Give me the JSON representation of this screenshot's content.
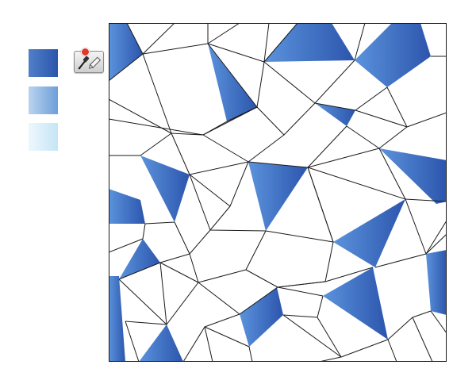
{
  "swatches": [
    {
      "name": "dark-blue-gradient",
      "from": "#4f80c8",
      "to": "#2c55ad"
    },
    {
      "name": "medium-blue-gradient",
      "from": "#b9d4ee",
      "to": "#6d9ed9"
    },
    {
      "name": "light-blue-gradient",
      "from": "#eef7fd",
      "to": "#c5e5f6"
    }
  ],
  "tool": {
    "icon": "eyedropper-icon",
    "secondary_icon": "pencil-icon",
    "badge_color": "#e1382a"
  },
  "canvas": {
    "background": "#ffffff",
    "stroke": "#1a1a1a",
    "fill_gradient": {
      "from": "#5b93dc",
      "to": "#2c55ad"
    }
  }
}
